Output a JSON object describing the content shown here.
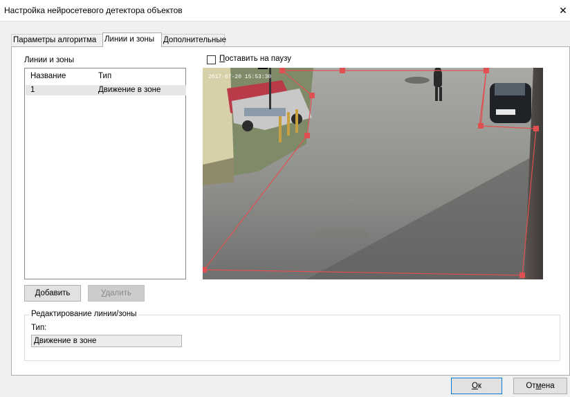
{
  "window": {
    "title": "Настройка нейросетевого детектора объектов",
    "close_glyph": "✕"
  },
  "tabs": [
    {
      "label": "Параметры алгоритма",
      "active": false
    },
    {
      "label": "Линии и зоны",
      "active": true
    },
    {
      "label": "Дополнительные",
      "active": false
    }
  ],
  "zones_panel": {
    "group_label": "Линии и зоны",
    "columns": [
      "Название",
      "Тип"
    ],
    "rows": [
      {
        "name": "1",
        "type": "Движение в зоне",
        "selected": true
      }
    ]
  },
  "pause_checkbox": {
    "accel": "П",
    "rest": "оставить на паузу",
    "checked": false
  },
  "video": {
    "timestamp": "2017-07-20 15:53:30",
    "zone_color": "#e05050"
  },
  "buttons": {
    "add": {
      "accel": "Д",
      "rest": "обавить",
      "enabled": true
    },
    "delete": {
      "accel": "У",
      "rest": "далить",
      "enabled": false
    },
    "ok": {
      "accel": "О",
      "rest": "к"
    },
    "cancel": {
      "pre": "От",
      "accel": "м",
      "rest": "ена"
    }
  },
  "edit_group": {
    "title": "Редактирование линии/зоны",
    "type_label": "Тип:",
    "type_value": "Движение в зоне"
  }
}
